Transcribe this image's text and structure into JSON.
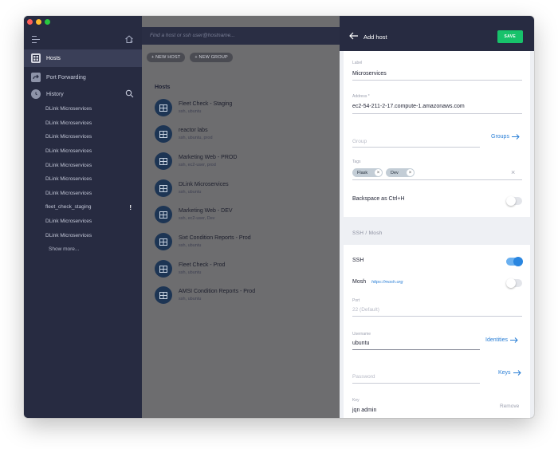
{
  "window": {
    "traffic_colors": [
      "#ff5f57",
      "#febc2e",
      "#28c840"
    ]
  },
  "sidebar": {
    "nav": [
      {
        "label": "Hosts",
        "icon": "grid-icon"
      },
      {
        "label": "Port Forwarding",
        "icon": "forward-icon"
      },
      {
        "label": "History",
        "icon": "clock-icon"
      }
    ],
    "recent": [
      {
        "label": "DLink Microservices"
      },
      {
        "label": "DLink Microservices"
      },
      {
        "label": "DLink Microservices"
      },
      {
        "label": "DLink Microservices"
      },
      {
        "label": "DLink Microservices"
      },
      {
        "label": "DLink Microservices"
      },
      {
        "label": "DLink Microservices"
      },
      {
        "label": "fleet_check_staging",
        "warning": "!"
      },
      {
        "label": "DLink Microservices"
      },
      {
        "label": "DLink Microservices"
      }
    ],
    "show_more": "Show more..."
  },
  "main": {
    "search_placeholder": "Find a host or ssh user@hostname...",
    "new_host": "+ NEW HOST",
    "new_group": "+ NEW GROUP",
    "section_title": "Hosts",
    "hosts": [
      {
        "name": "Fleet Check - Staging",
        "sub": "ssh, ubuntu"
      },
      {
        "name": "reactor labs",
        "sub": "ssh, ubuntu, prod"
      },
      {
        "name": "Marketing Web - PROD",
        "sub": "ssh, ec2-user, prod"
      },
      {
        "name": "DLink Microservices",
        "sub": "ssh, ubuntu"
      },
      {
        "name": "Marketing Web - DEV",
        "sub": "ssh, ec2-user, Dev"
      },
      {
        "name": "Sixt Condition Reports - Prod",
        "sub": "ssh, ubuntu"
      },
      {
        "name": "Fleet Check - Prod",
        "sub": "ssh, ubuntu"
      },
      {
        "name": "AMSI Condition Reports - Prod",
        "sub": "ssh, ubuntu"
      }
    ]
  },
  "panel": {
    "title": "Add host",
    "save": "SAVE",
    "label_label": "Label",
    "label_value": "Microservices",
    "address_label": "Address *",
    "address_value": "ec2-54-211-2-17.compute-1.amazonaws.com",
    "group_placeholder": "Group",
    "groups_link": "Groups",
    "tags_label": "Tags",
    "tags": [
      "Flask",
      "Dev"
    ],
    "backspace_label": "Backspace as Ctrl+H",
    "backspace_on": false,
    "ssh_mosh_section": "SSH / Mosh",
    "ssh_label": "SSH",
    "ssh_on": true,
    "mosh_label": "Mosh",
    "mosh_link": "https://mosh.org",
    "mosh_on": false,
    "port_label": "Port",
    "port_placeholder": "22 (Default)",
    "username_label": "Username",
    "username_value": "ubuntu",
    "identities_link": "Identities",
    "password_placeholder": "Password",
    "keys_link": "Keys",
    "key_label": "Key",
    "key_value": "jqn admin",
    "remove_label": "Remove"
  },
  "colors": {
    "sidebar_bg": "#272b41",
    "accent_blue": "#2a7fd6",
    "save_green": "#17c26b"
  }
}
